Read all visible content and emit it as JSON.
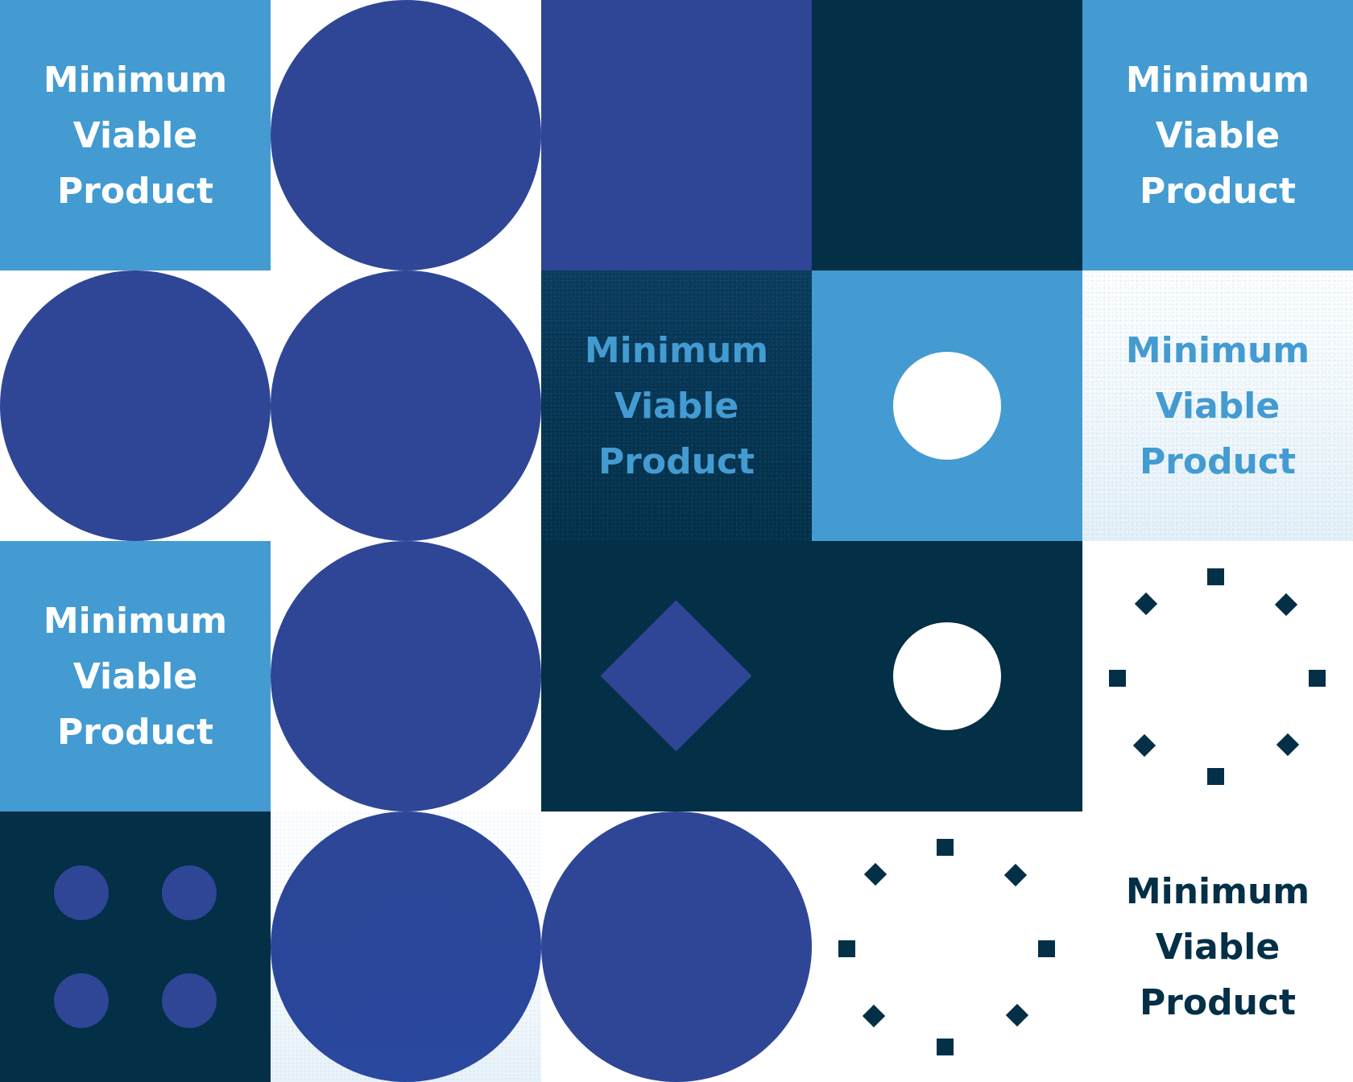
{
  "title": "Minimum Viable Product pattern",
  "palette": {
    "light_blue": "#439bd1",
    "royal_blue": "#2e4695",
    "navy": "#032f47",
    "white": "#ffffff"
  },
  "tagline": {
    "line1": "Minimum",
    "line2": "Viable",
    "line3": "Product"
  },
  "tiles": [
    {
      "row": 1,
      "col": 1,
      "background": "light-blue",
      "content": "text",
      "text_color": "white"
    },
    {
      "row": 1,
      "col": 2,
      "background": "white",
      "content": "circle",
      "shape_color": "royal-blue"
    },
    {
      "row": 1,
      "col": 3,
      "background": "royal-blue",
      "content": "none"
    },
    {
      "row": 1,
      "col": 4,
      "background": "navy",
      "content": "none"
    },
    {
      "row": 1,
      "col": 5,
      "background": "light-blue",
      "content": "text",
      "text_color": "white"
    },
    {
      "row": 2,
      "col": 1,
      "background": "white",
      "content": "circle",
      "shape_color": "royal-blue"
    },
    {
      "row": 2,
      "col": 2,
      "background": "white",
      "content": "circle",
      "shape_color": "royal-blue"
    },
    {
      "row": 2,
      "col": 3,
      "background": "navy-textured",
      "content": "text",
      "text_color": "light-blue"
    },
    {
      "row": 2,
      "col": 4,
      "background": "light-blue",
      "content": "white-dot"
    },
    {
      "row": 2,
      "col": 5,
      "background": "white-textured",
      "content": "text",
      "text_color": "light-blue"
    },
    {
      "row": 3,
      "col": 1,
      "background": "light-blue",
      "content": "text",
      "text_color": "white"
    },
    {
      "row": 3,
      "col": 2,
      "background": "white",
      "content": "circle",
      "shape_color": "royal-blue"
    },
    {
      "row": 3,
      "col": 3,
      "background": "navy",
      "content": "diamond",
      "shape_color": "royal-blue"
    },
    {
      "row": 3,
      "col": 4,
      "background": "navy",
      "content": "white-dot"
    },
    {
      "row": 3,
      "col": 5,
      "background": "white",
      "content": "marker-ring",
      "shape_color": "navy"
    },
    {
      "row": 4,
      "col": 1,
      "background": "navy",
      "content": "four-dots",
      "shape_color": "royal-blue"
    },
    {
      "row": 4,
      "col": 2,
      "background": "white-textured",
      "content": "circle-textured",
      "shape_color": "royal-blue"
    },
    {
      "row": 4,
      "col": 3,
      "background": "white",
      "content": "circle",
      "shape_color": "royal-blue"
    },
    {
      "row": 4,
      "col": 4,
      "background": "white",
      "content": "marker-ring",
      "shape_color": "navy"
    },
    {
      "row": 4,
      "col": 5,
      "background": "white",
      "content": "text",
      "text_color": "navy"
    }
  ]
}
